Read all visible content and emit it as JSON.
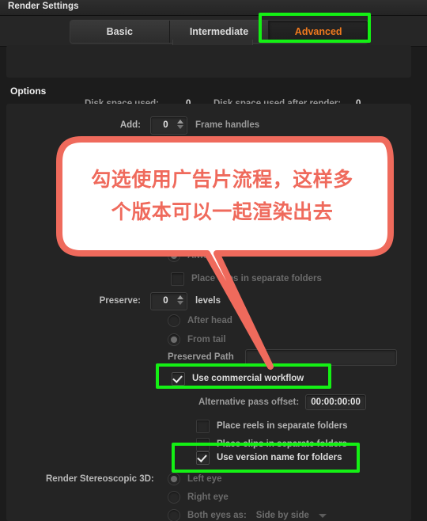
{
  "window": {
    "title": "Render Settings"
  },
  "tabs": [
    {
      "label": "Basic",
      "selected": false
    },
    {
      "label": "Intermediate",
      "selected": false
    },
    {
      "label": "Advanced",
      "selected": true
    }
  ],
  "disk": {
    "used_label": "Disk space used:",
    "used_value": "0",
    "after_render_label": "Disk space used after render:",
    "after_render_value": "0"
  },
  "sections": {
    "options_title": "Options"
  },
  "fields": {
    "add_label": "Add:",
    "add_value": "0",
    "frame_handles_label": "Frame handles",
    "always_label": "Always",
    "place_clips_top_label": "Place clips in separate folders",
    "preserve_label": "Preserve:",
    "preserve_value": "0",
    "levels_label": "levels",
    "after_head_label": "After head",
    "from_tail_label": "From tail",
    "preserved_path_label": "Preserved Path",
    "preserved_path_value": "",
    "use_commercial_workflow_label": "Use commercial workflow",
    "alternative_pass_offset_label": "Alternative pass offset:",
    "alternative_pass_offset_value": "00:00:00:00",
    "place_reels_label": "Place reels in separate folders",
    "place_clips_label": "Place clips in separate folders",
    "use_version_name_label": "Use version name for folders",
    "stereoscopic_label": "Render Stereoscopic 3D:",
    "left_eye_label": "Left eye",
    "right_eye_label": "Right eye",
    "both_eyes_label": "Both eyes as:",
    "both_eyes_value": "Side by side"
  },
  "annotation": {
    "bubble_line1": "勾选使用广告片流程，这样多",
    "bubble_line2": "个版本可以一起渲染出去",
    "bubble_color": "#ef6a5c",
    "highlight_color": "#14f014"
  }
}
